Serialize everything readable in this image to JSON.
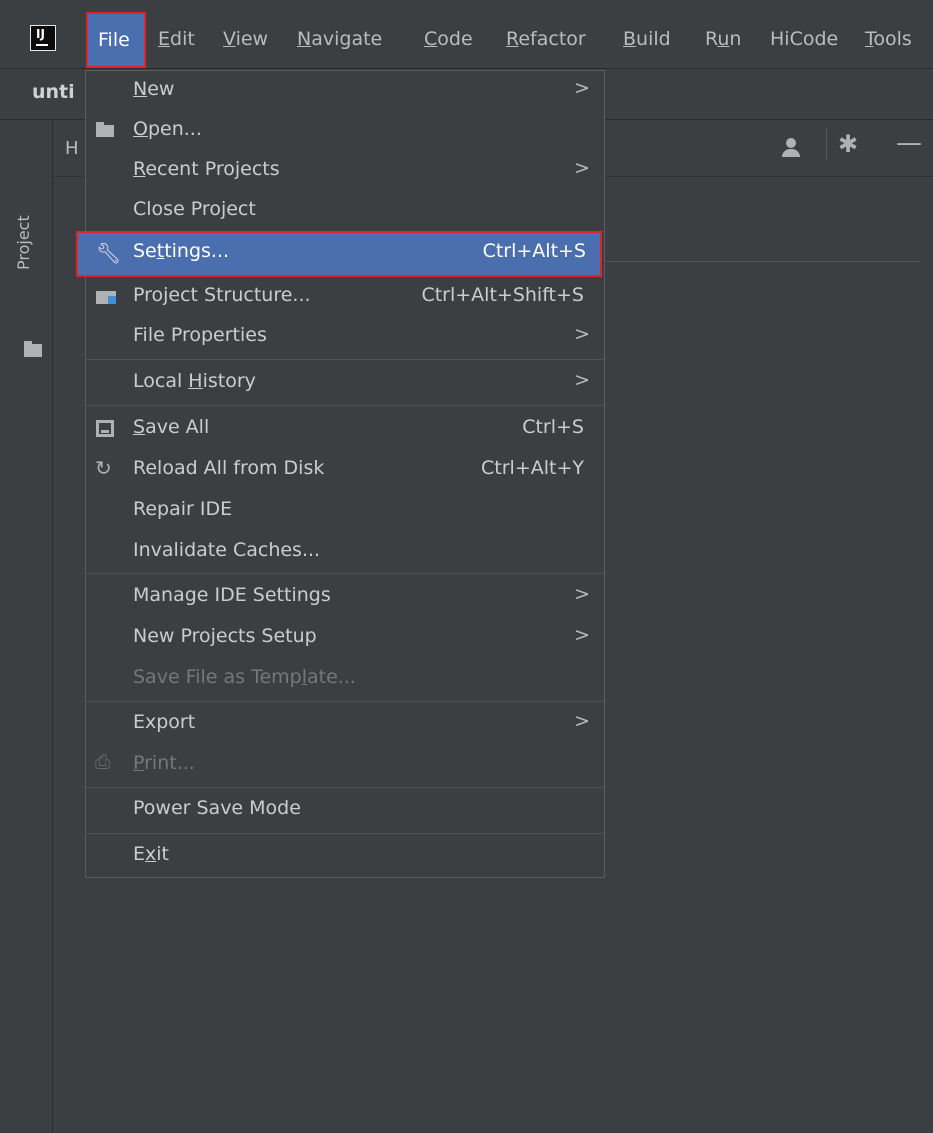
{
  "app": {
    "logo_text": "IJ"
  },
  "menubar": {
    "file": "File",
    "items": [
      {
        "pre": "",
        "ul": "E",
        "post": "dit"
      },
      {
        "pre": "",
        "ul": "V",
        "post": "iew"
      },
      {
        "pre": "",
        "ul": "N",
        "post": "avigate"
      },
      {
        "pre": "",
        "ul": "C",
        "post": "ode"
      },
      {
        "pre": "",
        "ul": "R",
        "post": "efactor"
      },
      {
        "pre": "",
        "ul": "B",
        "post": "uild"
      },
      {
        "pre": "R",
        "ul": "u",
        "post": "n"
      },
      {
        "pre": "HiCode",
        "ul": "",
        "post": ""
      },
      {
        "pre": "",
        "ul": "T",
        "post": "ools"
      }
    ]
  },
  "navbar": {
    "project_name": "unti"
  },
  "side_panel": {
    "label": "Project"
  },
  "tool_window": {
    "header_letter": "H"
  },
  "file_menu": {
    "items": [
      {
        "pre": "",
        "ul": "N",
        "post": "ew",
        "shortcut": "",
        "arrow": ">"
      },
      {
        "pre": "",
        "ul": "O",
        "post": "pen...",
        "shortcut": "",
        "arrow": ""
      },
      {
        "pre": "",
        "ul": "R",
        "post": "ecent Projects",
        "shortcut": "",
        "arrow": ">"
      },
      {
        "pre": "Close Project",
        "ul": "",
        "post": "",
        "shortcut": "",
        "arrow": ""
      },
      {
        "pre": "Se",
        "ul": "t",
        "post": "tings...",
        "shortcut": "Ctrl+Alt+S",
        "arrow": ""
      },
      {
        "pre": "Project Structure...",
        "ul": "",
        "post": "",
        "shortcut": "Ctrl+Alt+Shift+S",
        "arrow": ""
      },
      {
        "pre": "File Properties",
        "ul": "",
        "post": "",
        "shortcut": "",
        "arrow": ">"
      },
      {
        "pre": "Local ",
        "ul": "H",
        "post": "istory",
        "shortcut": "",
        "arrow": ">"
      },
      {
        "pre": "",
        "ul": "S",
        "post": "ave All",
        "shortcut": "Ctrl+S",
        "arrow": ""
      },
      {
        "pre": "Reload All from Disk",
        "ul": "",
        "post": "",
        "shortcut": "Ctrl+Alt+Y",
        "arrow": ""
      },
      {
        "pre": "Repair IDE",
        "ul": "",
        "post": "",
        "shortcut": "",
        "arrow": ""
      },
      {
        "pre": "Invalidate Caches...",
        "ul": "",
        "post": "",
        "shortcut": "",
        "arrow": ""
      },
      {
        "pre": "Manage IDE Settings",
        "ul": "",
        "post": "",
        "shortcut": "",
        "arrow": ">"
      },
      {
        "pre": "New Projects Setup",
        "ul": "",
        "post": "",
        "shortcut": "",
        "arrow": ">"
      },
      {
        "pre": "Save File as Temp",
        "ul": "l",
        "post": "ate...",
        "shortcut": "",
        "arrow": ""
      },
      {
        "pre": "Export",
        "ul": "",
        "post": "",
        "shortcut": "",
        "arrow": ">"
      },
      {
        "pre": "",
        "ul": "P",
        "post": "rint...",
        "shortcut": "",
        "arrow": ""
      },
      {
        "pre": "Power Save Mode",
        "ul": "",
        "post": "",
        "shortcut": "",
        "arrow": ""
      },
      {
        "pre": "E",
        "ul": "x",
        "post": "it",
        "shortcut": "",
        "arrow": ""
      }
    ]
  },
  "colors": {
    "background": "#3c3f41",
    "selection": "#4b6eaf",
    "highlight_border": "#d9262c"
  },
  "icons": [
    "app-logo-icon",
    "folder-open-icon",
    "wrench-icon",
    "project-structure-icon",
    "save-icon",
    "reload-icon",
    "print-icon",
    "user-icon",
    "gear-icon",
    "minimize-icon",
    "folder-icon"
  ]
}
